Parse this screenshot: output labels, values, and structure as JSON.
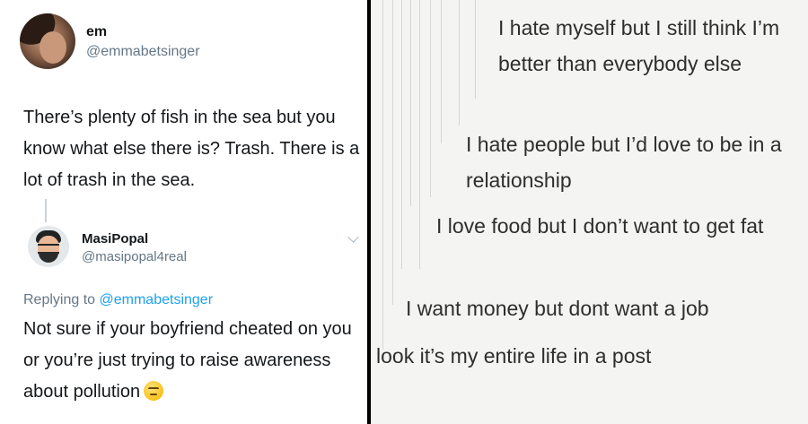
{
  "tweet": {
    "author_name": "em",
    "author_handle": "@emmabetsinger",
    "text": "There’s plenty of fish in the sea but you know what else there is? Trash. There is a lot of trash in the sea."
  },
  "reply": {
    "author_name": "MasiPopal",
    "author_handle": "@masipopal4real",
    "replying_prefix": "Replying to",
    "replying_to": "@emmabetsinger",
    "text": "Not sure if your boyfriend cheated on you or you’re just trying to raise awareness about pollution",
    "emoji": "thinking-face-emoji"
  },
  "tumblr_post": {
    "lines": [
      "I hate myself but I still think I’m better than everybody else",
      "I hate people but I’d love to be in a relationship",
      "I love food but I don’t want to get fat",
      "I want money but dont want a job",
      "look it’s my entire life in a post"
    ]
  },
  "colors": {
    "text": "#14171a",
    "muted": "#657786",
    "link": "#1da1f2",
    "divider": "#000000",
    "tumblr_bg": "#f4f4f2",
    "tumblr_text": "#2e2e2e"
  }
}
